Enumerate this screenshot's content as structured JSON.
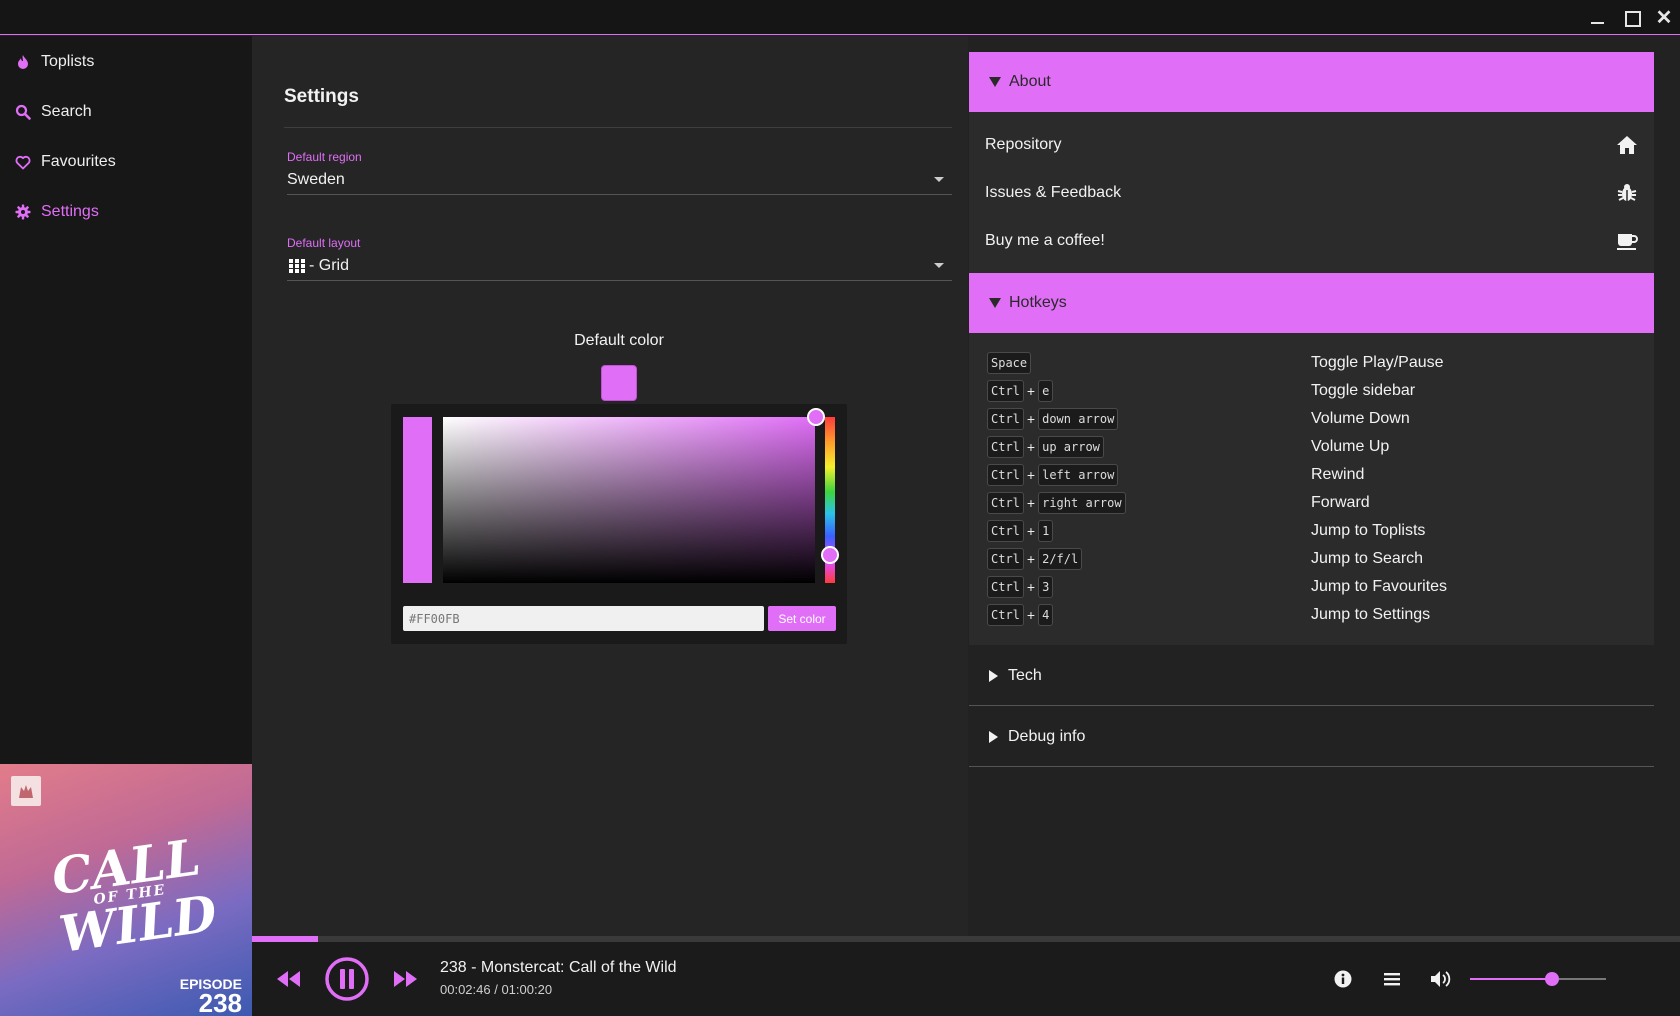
{
  "window": {
    "minimize_glyph": "",
    "maximize_glyph": "",
    "close_glyph": "✕"
  },
  "sidebar": {
    "items": [
      {
        "label": "Toplists",
        "icon": "flame-icon"
      },
      {
        "label": "Search",
        "icon": "search-icon"
      },
      {
        "label": "Favourites",
        "icon": "heart-icon"
      },
      {
        "label": "Settings",
        "icon": "gear-icon",
        "active": true
      }
    ]
  },
  "album_art": {
    "line1": "CALL",
    "line2": "OF THE",
    "line3": "WILD",
    "episode_label": "EPISODE",
    "episode_number": "238"
  },
  "settings": {
    "title": "Settings",
    "region": {
      "label": "Default region",
      "value": "Sweden"
    },
    "layout": {
      "label": "Default layout",
      "value": "- Grid"
    },
    "color": {
      "label": "Default color",
      "hex_placeholder": "#FF00FB",
      "set_button": "Set color"
    }
  },
  "about": {
    "header": "About",
    "items": [
      {
        "label": "Repository",
        "icon": "home-icon"
      },
      {
        "label": "Issues & Feedback",
        "icon": "bug-icon"
      },
      {
        "label": "Buy me a coffee!",
        "icon": "coffee-icon"
      }
    ]
  },
  "hotkeys": {
    "header": "Hotkeys",
    "plus": "+",
    "items": [
      {
        "keys": [
          "Space"
        ],
        "action": "Toggle Play/Pause"
      },
      {
        "keys": [
          "Ctrl",
          "e"
        ],
        "action": "Toggle sidebar"
      },
      {
        "keys": [
          "Ctrl",
          "down arrow"
        ],
        "action": "Volume Down"
      },
      {
        "keys": [
          "Ctrl",
          "up arrow"
        ],
        "action": "Volume Up"
      },
      {
        "keys": [
          "Ctrl",
          "left arrow"
        ],
        "action": "Rewind"
      },
      {
        "keys": [
          "Ctrl",
          "right arrow"
        ],
        "action": "Forward"
      },
      {
        "keys": [
          "Ctrl",
          "1"
        ],
        "action": "Jump to Toplists"
      },
      {
        "keys": [
          "Ctrl",
          "2/f/l"
        ],
        "action": "Jump to Search"
      },
      {
        "keys": [
          "Ctrl",
          "3"
        ],
        "action": "Jump to Favourites"
      },
      {
        "keys": [
          "Ctrl",
          "4"
        ],
        "action": "Jump to Settings"
      }
    ]
  },
  "tech": {
    "header": "Tech"
  },
  "debug": {
    "header": "Debug info"
  },
  "player": {
    "track_title": "238 - Monstercat: Call of the Wild",
    "elapsed": "00:02:46",
    "duration": "01:00:20",
    "time_display": "00:02:46 / 01:00:20",
    "progress_fraction": 0.046,
    "volume_fraction": 0.6
  },
  "colors": {
    "accent": "#e06ef7",
    "background": "#222222",
    "sidebar": "#171717"
  }
}
